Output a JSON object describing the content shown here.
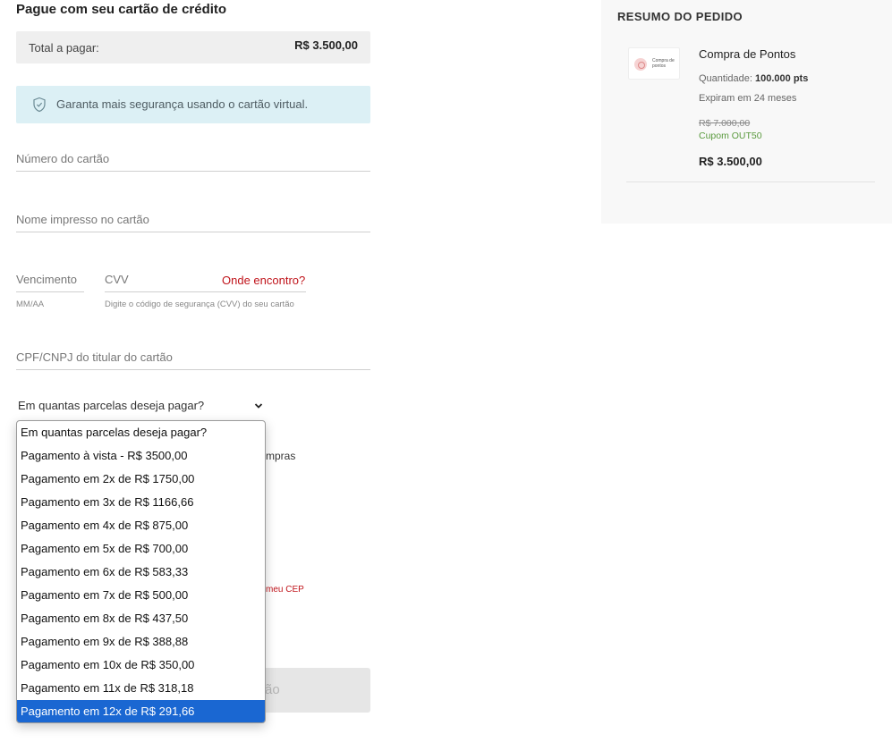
{
  "checkout": {
    "title": "Pague com seu cartão de crédito",
    "total_label": "Total a pagar:",
    "total_value": "R$ 3.500,00",
    "security_notice": "Garanta mais segurança usando o cartão virtual.",
    "card_number_placeholder": "Número do cartão",
    "card_name_placeholder": "Nome impresso no cartão",
    "expiry_placeholder": "Vencimento",
    "expiry_hint": "MM/AA",
    "cvv_placeholder": "CVV",
    "cvv_help_link": "Onde encontro?",
    "cvv_hint": "Digite o código de segurança (CVV) do seu cartão",
    "document_placeholder": "CPF/CNPJ do titular do cartão",
    "installments_label": "Em quantas parcelas deseja pagar?",
    "partial_text_behind": "mpras",
    "partial_cep_link": "meu CEP",
    "partial_button_text": "ão"
  },
  "installments": {
    "options": [
      "Em quantas parcelas deseja pagar?",
      "Pagamento à vista - R$ 3500,00",
      "Pagamento em 2x de R$ 1750,00",
      "Pagamento em 3x de R$ 1166,66",
      "Pagamento em 4x de R$ 875,00",
      "Pagamento em 5x de R$ 700,00",
      "Pagamento em 6x de R$ 583,33",
      "Pagamento em 7x de R$ 500,00",
      "Pagamento em 8x de R$ 437,50",
      "Pagamento em 9x de R$ 388,88",
      "Pagamento em 10x de R$ 350,00",
      "Pagamento em 11x de R$ 318,18",
      "Pagamento em 12x de R$ 291,66"
    ],
    "highlighted": "Pagamento em 12x de R$ 291,66"
  },
  "summary": {
    "title": "RESUMO DO PEDIDO",
    "thumbnail_text": "Compra de pontos",
    "product_name": "Compra de Pontos",
    "quantity_label": "Quantidade:",
    "quantity_value": "100.000 pts",
    "expiry": "Expiram em 24 meses",
    "original_price": "R$ 7.000,00",
    "coupon": "Cupom OUT50",
    "final_price": "R$ 3.500,00"
  },
  "colors": {
    "accent_red": "#c0141b",
    "highlight_blue": "#1a67d2",
    "coupon_green": "#5a9a3e",
    "security_bg": "#dcf0f5"
  },
  "icons": [
    "shield-check-icon",
    "chevron-down-icon",
    "points-logo-icon"
  ]
}
